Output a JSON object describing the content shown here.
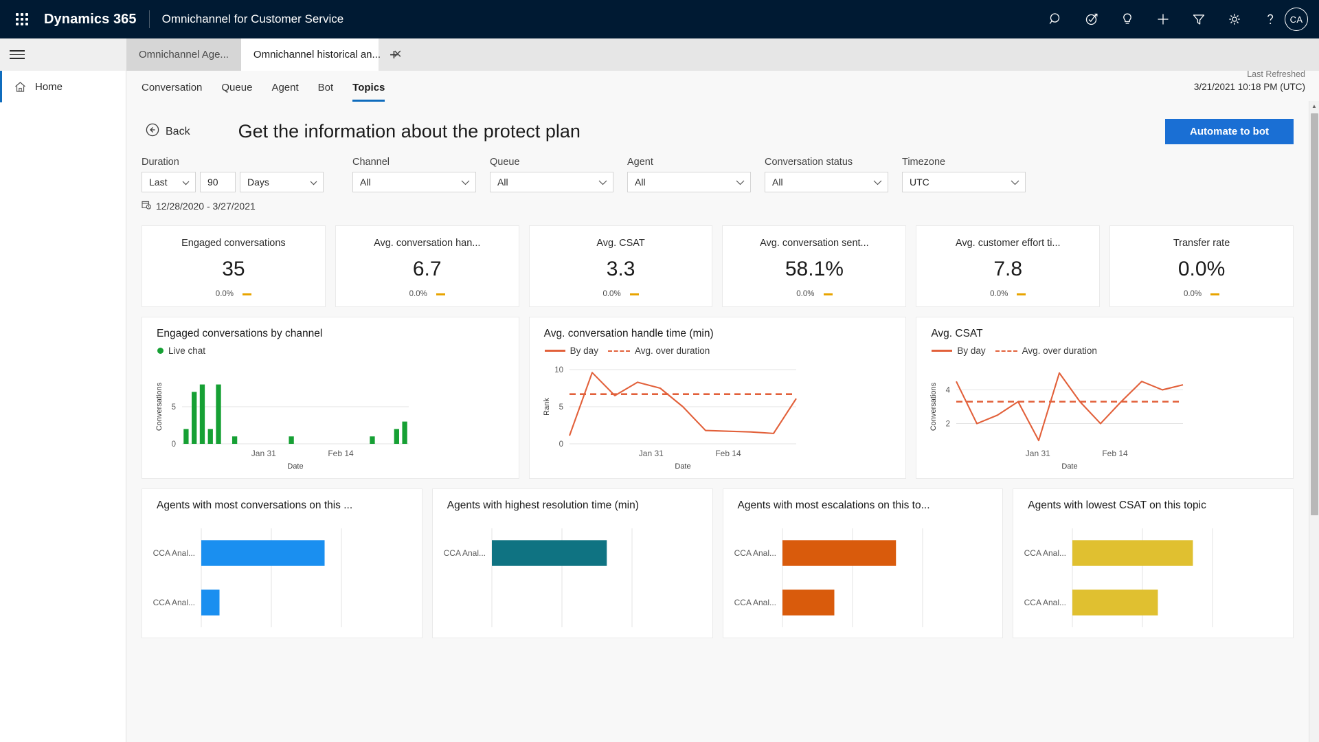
{
  "topbar": {
    "waffle_label": "app-launcher",
    "brand": "Dynamics 365",
    "app_name": "Omnichannel for Customer Service",
    "icons": [
      "search-icon",
      "assistant-icon",
      "lightbulb-icon",
      "plus-icon",
      "filter-icon",
      "gear-icon",
      "help-icon"
    ],
    "avatar_initials": "CA",
    "bg_color": "#001a33"
  },
  "browser_tabs": [
    {
      "label": "Omnichannel Age...",
      "active": false
    },
    {
      "label": "Omnichannel historical an...",
      "active": true
    }
  ],
  "new_tab_label": "+",
  "sidebar": {
    "items": [
      {
        "label": "Home",
        "icon": "home-icon",
        "active": true
      }
    ]
  },
  "module_tabs": [
    {
      "label": "Conversation",
      "active": false
    },
    {
      "label": "Queue",
      "active": false
    },
    {
      "label": "Agent",
      "active": false
    },
    {
      "label": "Bot",
      "active": false
    },
    {
      "label": "Topics",
      "active": true
    }
  ],
  "refresh": {
    "label": "Last Refreshed",
    "timestamp": "3/21/2021 10:18 PM (UTC)"
  },
  "page": {
    "back_label": "Back",
    "title": "Get the information about the protect plan",
    "automate_label": "Automate to bot",
    "accent_color": "#1a6fd4"
  },
  "filters": {
    "duration": {
      "label": "Duration",
      "operator": "Last",
      "amount": "90",
      "unit": "Days"
    },
    "channel": {
      "label": "Channel",
      "value": "All"
    },
    "queue": {
      "label": "Queue",
      "value": "All"
    },
    "agent": {
      "label": "Agent",
      "value": "All"
    },
    "conversation_status": {
      "label": "Conversation status",
      "value": "All"
    },
    "timezone": {
      "label": "Timezone",
      "value": "UTC"
    },
    "date_range": "12/28/2020 - 3/27/2021"
  },
  "kpis": [
    {
      "title": "Engaged conversations",
      "value": "35",
      "delta": "0.0%",
      "trend": "flat"
    },
    {
      "title": "Avg. conversation han...",
      "value": "6.7",
      "delta": "0.0%",
      "trend": "flat"
    },
    {
      "title": "Avg. CSAT",
      "value": "3.3",
      "delta": "0.0%",
      "trend": "flat"
    },
    {
      "title": "Avg. conversation sent...",
      "value": "58.1%",
      "delta": "0.0%",
      "trend": "flat"
    },
    {
      "title": "Avg. customer effort ti...",
      "value": "7.8",
      "delta": "0.0%",
      "trend": "flat"
    },
    {
      "title": "Transfer rate",
      "value": "0.0%",
      "delta": "0.0%",
      "trend": "flat"
    }
  ],
  "chart_data": [
    {
      "id": "engaged-by-channel",
      "type": "bar",
      "title": "Engaged conversations by channel",
      "legend": [
        "Live chat"
      ],
      "legend_position": "top-left",
      "series_color": "#16a034",
      "xlabel": "Date",
      "ylabel": "Conversations",
      "ylim": [
        0,
        10
      ],
      "yticks": [
        0,
        5
      ],
      "xticks": [
        "Jan 31",
        "Feb 14"
      ],
      "x": [
        "d1",
        "d2",
        "d3",
        "d4",
        "d5",
        "d6",
        "d7",
        "d8",
        "d9",
        "d10",
        "d11",
        "d12",
        "d13",
        "d14",
        "d15",
        "d16",
        "d17",
        "d18",
        "d19",
        "d20",
        "d21",
        "d22",
        "d23",
        "d24",
        "d25",
        "d26",
        "d27",
        "d28"
      ],
      "values": [
        2,
        7,
        8,
        2,
        8,
        0,
        1,
        0,
        0,
        0,
        0,
        0,
        0,
        1,
        0,
        0,
        0,
        0,
        0,
        0,
        0,
        0,
        0,
        1,
        0,
        0,
        2,
        3
      ]
    },
    {
      "id": "avg-handle-time",
      "type": "line",
      "title": "Avg. conversation handle time (min)",
      "legend": [
        "By day",
        "Avg. over duration"
      ],
      "legend_position": "top-left",
      "series_color": "#e2603a",
      "xlabel": "Date",
      "ylabel": "Rank",
      "ylim": [
        0,
        10
      ],
      "yticks": [
        0,
        5,
        10
      ],
      "xticks": [
        "Jan 31",
        "Feb 14"
      ],
      "series": [
        {
          "name": "By day",
          "values": [
            1.1,
            9.6,
            6.5,
            8.3,
            7.5,
            5.0,
            1.8,
            1.7,
            1.6,
            1.4,
            6.1
          ]
        },
        {
          "name": "Avg. over duration",
          "values": [
            6.7,
            6.7,
            6.7,
            6.7,
            6.7,
            6.7,
            6.7,
            6.7,
            6.7,
            6.7,
            6.7
          ],
          "dashed": true
        }
      ]
    },
    {
      "id": "avg-csat",
      "type": "line",
      "title": "Avg. CSAT",
      "legend": [
        "By day",
        "Avg. over duration"
      ],
      "legend_position": "top-left",
      "series_color": "#e2603a",
      "xlabel": "Date",
      "ylabel": "Conversations",
      "ylim": [
        0.8,
        5.2
      ],
      "yticks": [
        2,
        4
      ],
      "xticks": [
        "Jan 31",
        "Feb 14"
      ],
      "series": [
        {
          "name": "By day",
          "values": [
            4.5,
            2.0,
            2.5,
            3.3,
            1.0,
            5.0,
            3.3,
            2.0,
            3.3,
            4.5,
            4.0,
            4.3
          ]
        },
        {
          "name": "Avg. over duration",
          "values": [
            3.3,
            3.3,
            3.3,
            3.3,
            3.3,
            3.3,
            3.3,
            3.3,
            3.3,
            3.3,
            3.3,
            3.3
          ],
          "dashed": true
        }
      ]
    },
    {
      "id": "agents-most-conversations",
      "type": "bar",
      "orientation": "horizontal",
      "title": "Agents with most conversations on this ...",
      "series_color": "#1a8ff0",
      "categories": [
        "CCA Anal...",
        "CCA Anal..."
      ],
      "values": [
        88,
        13
      ],
      "xlim": [
        0,
        100
      ],
      "gridlines": [
        0,
        50,
        100
      ]
    },
    {
      "id": "agents-highest-resolution-time",
      "type": "bar",
      "orientation": "horizontal",
      "title": "Agents with highest resolution time (min)",
      "series_color": "#0f7382",
      "categories": [
        "CCA Anal..."
      ],
      "values": [
        82
      ],
      "xlim": [
        0,
        100
      ],
      "gridlines": [
        0,
        50,
        100
      ]
    },
    {
      "id": "agents-most-escalations",
      "type": "bar",
      "orientation": "horizontal",
      "title": "Agents with most escalations on this to...",
      "series_color": "#d95b0c",
      "categories": [
        "CCA Anal...",
        "CCA Anal..."
      ],
      "values": [
        81,
        37
      ],
      "xlim": [
        0,
        100
      ],
      "gridlines": [
        0,
        50,
        100
      ]
    },
    {
      "id": "agents-lowest-csat",
      "type": "bar",
      "orientation": "horizontal",
      "title": "Agents with lowest CSAT on this topic",
      "series_color": "#e0c030",
      "categories": [
        "CCA Anal...",
        "CCA Anal..."
      ],
      "values": [
        86,
        61
      ],
      "xlim": [
        0,
        100
      ],
      "gridlines": [
        0,
        50,
        100
      ]
    }
  ]
}
